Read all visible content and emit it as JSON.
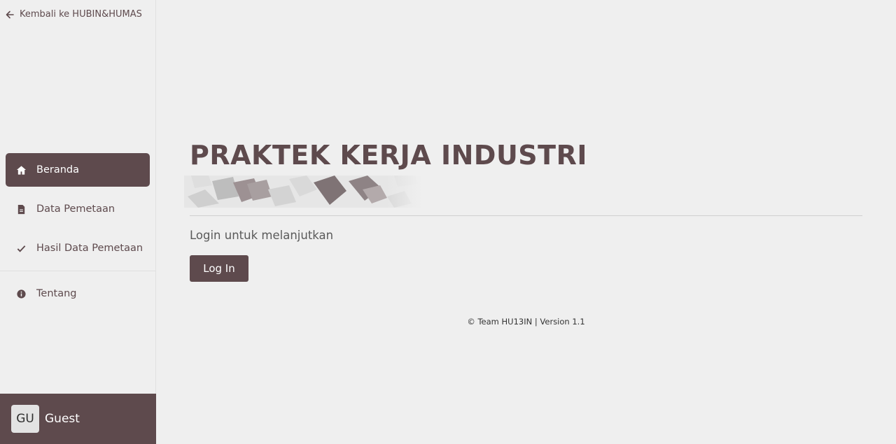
{
  "sidebar": {
    "back_link": "Kembali ke HUBIN&HUMAS",
    "items": [
      {
        "label": "Beranda",
        "icon": "home-icon",
        "active": true
      },
      {
        "label": "Data Pemetaan",
        "icon": "document-icon",
        "active": false
      },
      {
        "label": "Hasil Data Pemetaan",
        "icon": "check-icon",
        "active": false
      },
      {
        "label": "Tentang",
        "icon": "info-icon",
        "active": false
      }
    ],
    "user": {
      "initials": "GU",
      "name": "Guest"
    }
  },
  "main": {
    "title": "PRAKTEK KERJA INDUSTRI",
    "subtitle": "Login untuk melanjutkan",
    "login_label": "Log In",
    "footer": "© Team HU13IN | Version 1.1"
  },
  "colors": {
    "accent": "#5e4a4d",
    "background": "#efefef",
    "text_muted": "#5a5a5a"
  }
}
